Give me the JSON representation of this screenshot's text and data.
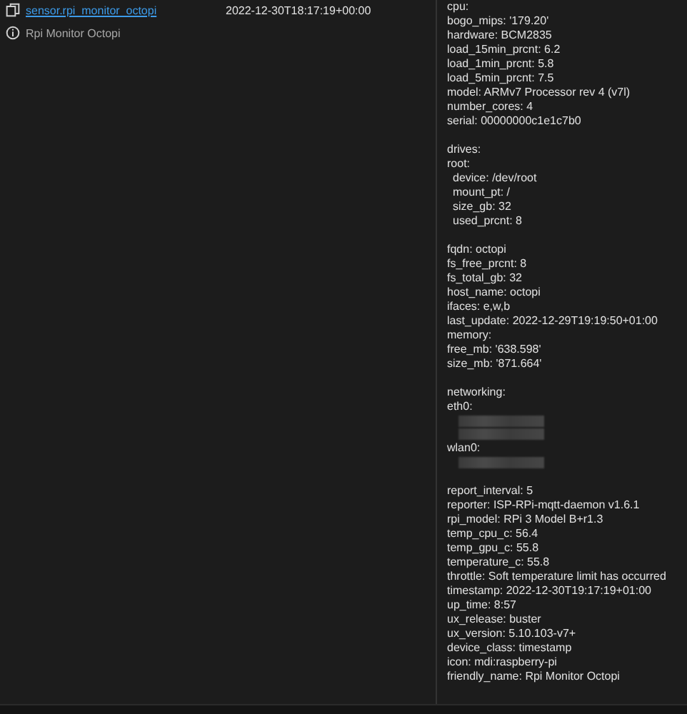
{
  "rows": [
    {
      "entity": "sensor.rpi_monitor_octopi",
      "friendly": "Rpi Monitor Octopi",
      "state": "2022-12-30T18:17:19+00:00",
      "attributes": [
        {
          "kind": "line",
          "text": "cpu:"
        },
        {
          "kind": "line",
          "text": "bogo_mips: '179.20'"
        },
        {
          "kind": "line",
          "text": "hardware: BCM2835"
        },
        {
          "kind": "line",
          "text": "load_15min_prcnt: 6.2"
        },
        {
          "kind": "line",
          "text": "load_1min_prcnt: 5.8"
        },
        {
          "kind": "line",
          "text": "load_5min_prcnt: 7.5"
        },
        {
          "kind": "line",
          "text": "model: ARMv7 Processor rev 4 (v7l)"
        },
        {
          "kind": "line",
          "text": "number_cores: 4"
        },
        {
          "kind": "line",
          "text": "serial: 00000000c1e1c7b0"
        },
        {
          "kind": "gap"
        },
        {
          "kind": "line",
          "text": "drives:"
        },
        {
          "kind": "line",
          "text": "root:",
          "children": [
            {
              "kind": "line",
              "text": "device: /dev/root"
            },
            {
              "kind": "line",
              "text": "mount_pt: /"
            },
            {
              "kind": "line",
              "text": "size_gb: 32"
            },
            {
              "kind": "line",
              "text": "used_prcnt: 8"
            }
          ]
        },
        {
          "kind": "gap"
        },
        {
          "kind": "line",
          "text": "fqdn: octopi"
        },
        {
          "kind": "line",
          "text": "fs_free_prcnt: 8"
        },
        {
          "kind": "line",
          "text": "fs_total_gb: 32"
        },
        {
          "kind": "line",
          "text": "host_name: octopi"
        },
        {
          "kind": "line",
          "text": "ifaces: e,w,b"
        },
        {
          "kind": "line",
          "text": "last_update: 2022-12-29T19:19:50+01:00"
        },
        {
          "kind": "line",
          "text": "memory:"
        },
        {
          "kind": "line",
          "text": "free_mb: '638.598'"
        },
        {
          "kind": "line",
          "text": "size_mb: '871.664'"
        },
        {
          "kind": "gap"
        },
        {
          "kind": "line",
          "text": "networking:"
        },
        {
          "kind": "line",
          "text": "eth0:",
          "children": [
            {
              "kind": "redacted"
            },
            {
              "kind": "redacted"
            }
          ]
        },
        {
          "kind": "line",
          "text": "wlan0:",
          "children": [
            {
              "kind": "redacted"
            }
          ]
        },
        {
          "kind": "gap"
        },
        {
          "kind": "line",
          "text": "report_interval: 5"
        },
        {
          "kind": "line",
          "text": "reporter: ISP-RPi-mqtt-daemon v1.6.1"
        },
        {
          "kind": "line",
          "text": "rpi_model: RPi 3 Model B+r1.3"
        },
        {
          "kind": "line",
          "text": "temp_cpu_c: 56.4"
        },
        {
          "kind": "line",
          "text": "temp_gpu_c: 55.8"
        },
        {
          "kind": "line",
          "text": "temperature_c: 55.8"
        },
        {
          "kind": "line",
          "text": "throttle: Soft temperature limit has occurred"
        },
        {
          "kind": "line",
          "text": "timestamp: 2022-12-30T19:17:19+01:00"
        },
        {
          "kind": "line",
          "text": "up_time:  8:57"
        },
        {
          "kind": "line",
          "text": "ux_release: buster"
        },
        {
          "kind": "line",
          "text": "ux_version: 5.10.103-v7+"
        },
        {
          "kind": "line",
          "text": "device_class: timestamp"
        },
        {
          "kind": "line",
          "text": "icon: mdi:raspberry-pi"
        },
        {
          "kind": "line",
          "text": "friendly_name: Rpi Monitor Octopi"
        }
      ]
    }
  ]
}
